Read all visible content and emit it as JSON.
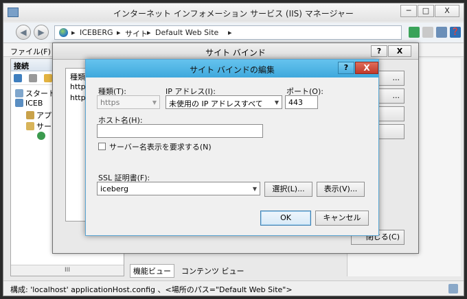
{
  "window": {
    "title": "インターネット インフォメーション サービス (IIS) マネージャー",
    "min_label": "─",
    "max_label": "□",
    "close_label": "X"
  },
  "address": {
    "back_label": "◀",
    "forward_label": "▶",
    "sep1": "▸",
    "crumb1": "ICEBERG",
    "sep2": "▸",
    "crumb2": "サイト",
    "sep3": "▸",
    "crumb3": "Default Web Site",
    "sep4": "▸",
    "help_label": "❓"
  },
  "menu": {
    "file_label": "ファイル(F)"
  },
  "connections": {
    "header": "接続",
    "tree": [
      {
        "label": "スタート"
      },
      {
        "label": "ICEB"
      },
      {
        "label": "アプ"
      },
      {
        "label": "サー"
      },
      {
        "label": ""
      }
    ]
  },
  "view_tabs": {
    "features": "機能ビュー",
    "content": "コンテンツ ビュー"
  },
  "scroll_label": "III",
  "status": {
    "text": "構成: 'localhost' applicationHost.config 、<場所のパス=\"Default Web Site\">"
  },
  "bindings_dialog": {
    "title": "サイト バインド",
    "help_label": "?",
    "close_label": "X",
    "list_header": "種類",
    "rows": [
      "http",
      "https"
    ],
    "side_buttons": [
      "...",
      "...",
      "",
      "",
      "閉じる(C)"
    ]
  },
  "edit_dialog": {
    "title": "サイト バインドの編集",
    "help_label": "?",
    "close_label": "X",
    "type_label": "種類(T):",
    "type_value": "https",
    "ip_label": "IP アドレス(I):",
    "ip_value": "未使用の IP アドレスすべて",
    "port_label": "ポート(O):",
    "port_value": "443",
    "host_label": "ホスト名(H):",
    "host_value": "",
    "sni_label": "サーバー名表示を要求する(N)",
    "sni_checked": false,
    "ssl_label": "SSL 証明書(F):",
    "ssl_value": "iceberg",
    "select_button": "選択(L)...",
    "view_button": "表示(V)...",
    "ok_button": "OK",
    "cancel_button": "キャンセル"
  }
}
